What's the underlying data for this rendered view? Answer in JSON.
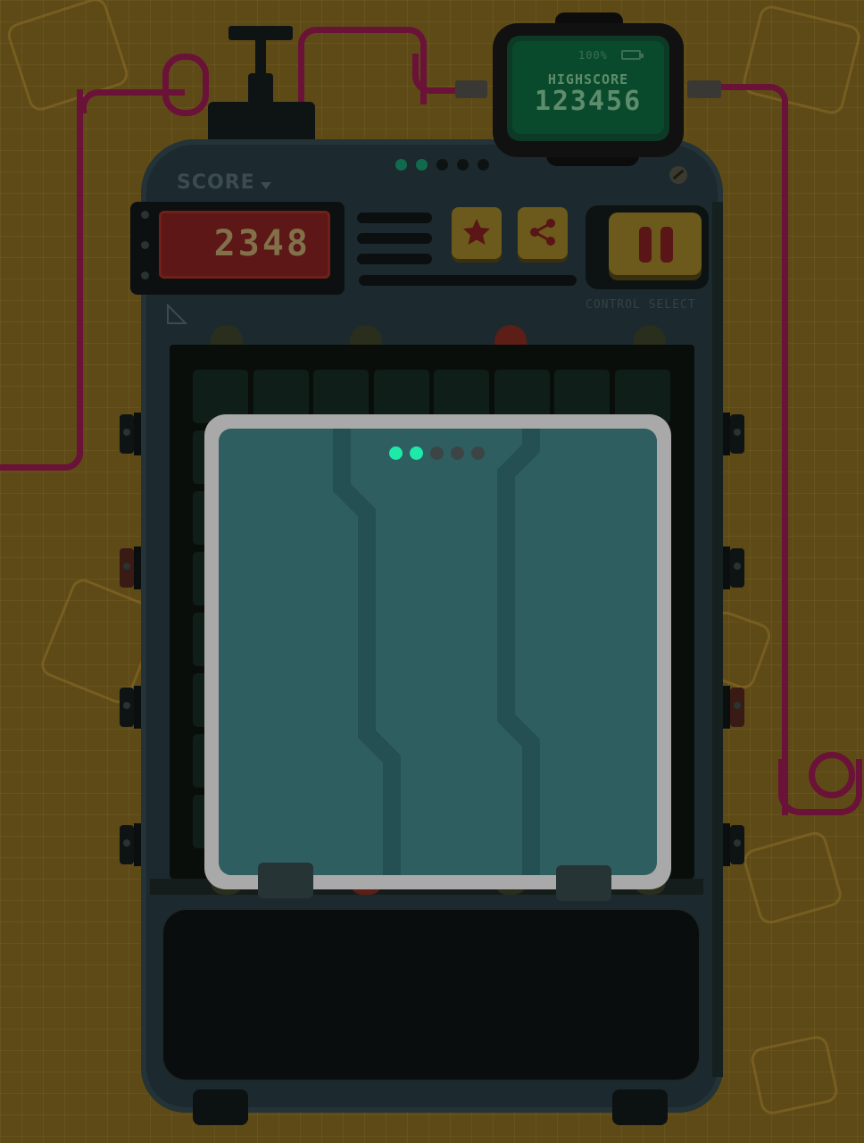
{
  "game": {
    "score_label": "SCORE",
    "score_value": "2348",
    "control_label": "CONTROL SELECT",
    "highscore": {
      "battery": "100%",
      "label": "HIGHSCORE",
      "value": "123456"
    },
    "buttons": {
      "favorite_icon": "star-icon",
      "share_icon": "share-icon",
      "pause_icon": "pause-icon"
    },
    "header_progress": {
      "total": 5,
      "active": 2
    },
    "modal_progress": {
      "total": 5,
      "active": 2
    }
  },
  "colors": {
    "background": "#5e4a17",
    "device": "#1c2a2f",
    "score_display": "#5c1716",
    "highscore_lcd": "#0a4a2c",
    "button_yellow": "#6b5a1c",
    "modal": "#2f5e60",
    "modal_frame": "#a9a9a9",
    "dot_active": "#1de9a8",
    "dot_inactive": "#3d4446",
    "wire": "#6b1238"
  }
}
